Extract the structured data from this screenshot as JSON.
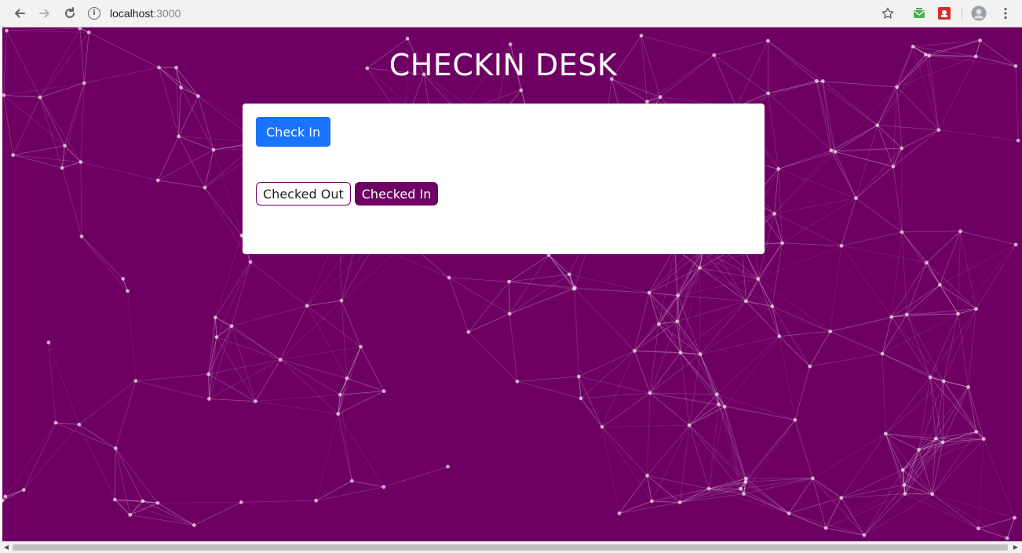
{
  "browser": {
    "url_host": "localhost",
    "url_port": ":3000",
    "back_icon": "arrow-left-icon",
    "forward_icon": "arrow-right-icon",
    "reload_icon": "reload-icon",
    "info_icon": "info-icon",
    "bookmark_icon": "star-icon",
    "menu_icon": "kebab-menu-icon"
  },
  "app": {
    "title": "CHECKIN DESK",
    "background_color": "#6e0063",
    "accent_color": "#1a73ff"
  },
  "card": {
    "checkin_button_label": "Check In",
    "status_toggle": {
      "options": [
        "Checked Out",
        "Checked In"
      ],
      "selected": "Checked In"
    }
  }
}
